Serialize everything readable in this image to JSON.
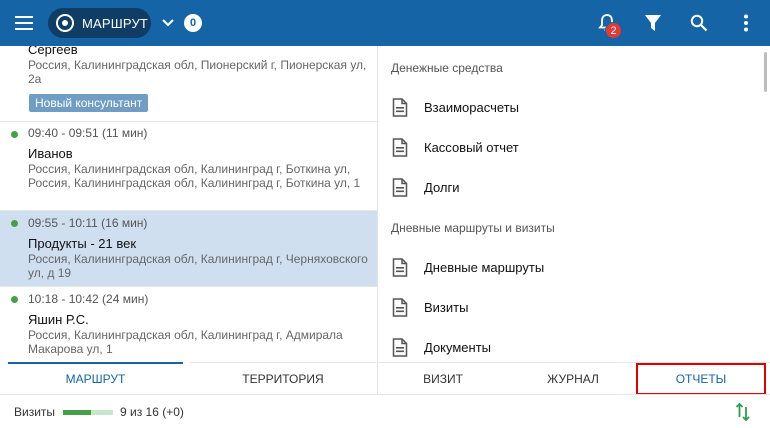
{
  "colors": {
    "header_bg": "#1565a6",
    "accent": "#1565a6",
    "visit_dot": "#43a047",
    "notification_badge": "#e53935",
    "selected_row": "#cfdff0",
    "highlight_box": "#e00000"
  },
  "header": {
    "route_label": "МАРШРУТ",
    "route_count": "0",
    "notification_count": "2",
    "icons": [
      "menu-icon",
      "route-target-icon",
      "chevron-down-icon",
      "bell-icon",
      "filter-icon",
      "search-icon",
      "more-vert-icon"
    ]
  },
  "visits": [
    {
      "time": "",
      "name": "Сергеев",
      "address": "Россия, Калининградская обл, Пионерский г, Пионерская ул, 2а",
      "badge": "Новый консультант",
      "selected": false
    },
    {
      "time": "09:40 - 09:51 (11 мин)",
      "name": "Иванов",
      "address": "Россия, Калининградская обл, Калининград г, Боткина ул, Россия, Калининградская обл, Калининград г, Боткина ул, 1",
      "selected": false
    },
    {
      "time": "09:55 - 10:11 (16 мин)",
      "name": "Продукты - 21 век",
      "address": "Россия, Калининградская обл, Калининград г, Черняховского ул, д 19",
      "selected": true
    },
    {
      "time": "10:18 - 10:42 (24 мин)",
      "name": "Яшин Р.С.",
      "address": "Россия, Калининградская обл, Калининград г, Адмирала Макарова ул, 1",
      "selected": false
    }
  ],
  "left_tabs": {
    "route": "МАРШРУТ",
    "territory": "ТЕРРИТОРИЯ"
  },
  "reports": {
    "section_money": "Денежные средства",
    "money_items": [
      "Взаиморасчеты",
      "Кассовый отчет",
      "Долги"
    ],
    "section_routes": "Дневные маршруты и визиты",
    "route_items": [
      "Дневные маршруты",
      "Визиты",
      "Документы"
    ]
  },
  "right_tabs": {
    "visit": "ВИЗИТ",
    "journal": "ЖУРНАЛ",
    "reports": "ОТЧЕТЫ"
  },
  "status": {
    "label": "Визиты",
    "count_text": "9 из 16 (+0)",
    "progress_fraction": 0.5625
  }
}
